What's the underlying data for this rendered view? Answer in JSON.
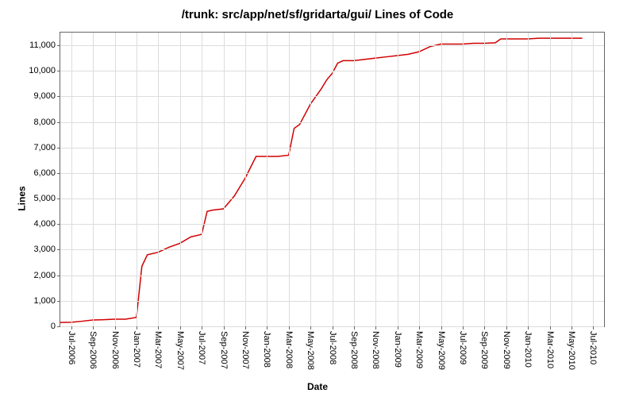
{
  "chart_data": {
    "type": "line",
    "title": "/trunk: src/app/net/sf/gridarta/gui/ Lines of Code",
    "xlabel": "Date",
    "ylabel": "Lines",
    "ylim": [
      0,
      11500
    ],
    "y_ticks": [
      0,
      1000,
      2000,
      3000,
      4000,
      5000,
      6000,
      7000,
      8000,
      9000,
      10000,
      11000
    ],
    "y_tick_labels": [
      "0",
      "1,000",
      "2,000",
      "3,000",
      "4,000",
      "5,000",
      "6,000",
      "7,000",
      "8,000",
      "9,000",
      "10,000",
      "11,000"
    ],
    "x_ticks": [
      "Jul-2006",
      "Sep-2006",
      "Nov-2006",
      "Jan-2007",
      "Mar-2007",
      "May-2007",
      "Jul-2007",
      "Sep-2007",
      "Nov-2007",
      "Jan-2008",
      "Mar-2008",
      "May-2008",
      "Jul-2008",
      "Sep-2008",
      "Nov-2008",
      "Jan-2009",
      "Mar-2009",
      "May-2009",
      "Jul-2009",
      "Sep-2009",
      "Nov-2009",
      "Jan-2010",
      "Mar-2010",
      "May-2010",
      "Jul-2010"
    ],
    "series": [
      {
        "name": "Lines of Code",
        "color": "#d00000",
        "points": [
          {
            "x": "Jun-2006",
            "y": 150
          },
          {
            "x": "Jul-2006",
            "y": 160
          },
          {
            "x": "Aug-2006",
            "y": 200
          },
          {
            "x": "Sep-2006",
            "y": 250
          },
          {
            "x": "Oct-2006",
            "y": 260
          },
          {
            "x": "Nov-2006",
            "y": 280
          },
          {
            "x": "Dec-2006",
            "y": 280
          },
          {
            "x": "Jan-2007",
            "y": 350
          },
          {
            "x": "Jan-2007b",
            "y": 2350
          },
          {
            "x": "Feb-2007",
            "y": 2800
          },
          {
            "x": "Mar-2007",
            "y": 2900
          },
          {
            "x": "Apr-2007",
            "y": 3100
          },
          {
            "x": "May-2007",
            "y": 3250
          },
          {
            "x": "Jun-2007",
            "y": 3500
          },
          {
            "x": "Jul-2007",
            "y": 3600
          },
          {
            "x": "Jul-2007b",
            "y": 4500
          },
          {
            "x": "Aug-2007",
            "y": 4550
          },
          {
            "x": "Sep-2007",
            "y": 4600
          },
          {
            "x": "Oct-2007",
            "y": 5100
          },
          {
            "x": "Oct-2007b",
            "y": 5450
          },
          {
            "x": "Nov-2007",
            "y": 5800
          },
          {
            "x": "Dec-2007",
            "y": 6650
          },
          {
            "x": "Jan-2008",
            "y": 6650
          },
          {
            "x": "Feb-2008",
            "y": 6650
          },
          {
            "x": "Mar-2008",
            "y": 6700
          },
          {
            "x": "Mar-2008b",
            "y": 7750
          },
          {
            "x": "Apr-2008",
            "y": 7900
          },
          {
            "x": "May-2008",
            "y": 8700
          },
          {
            "x": "Jun-2008",
            "y": 9300
          },
          {
            "x": "Jun-2008b",
            "y": 9650
          },
          {
            "x": "Jul-2008",
            "y": 9900
          },
          {
            "x": "Jul-2008b",
            "y": 10300
          },
          {
            "x": "Aug-2008",
            "y": 10400
          },
          {
            "x": "Sep-2008",
            "y": 10400
          },
          {
            "x": "Oct-2008",
            "y": 10450
          },
          {
            "x": "Nov-2008",
            "y": 10500
          },
          {
            "x": "Dec-2008",
            "y": 10550
          },
          {
            "x": "Jan-2009",
            "y": 10600
          },
          {
            "x": "Feb-2009",
            "y": 10650
          },
          {
            "x": "Mar-2009",
            "y": 10750
          },
          {
            "x": "Apr-2009",
            "y": 10950
          },
          {
            "x": "Apr-2009b",
            "y": 11000
          },
          {
            "x": "May-2009",
            "y": 11050
          },
          {
            "x": "Jun-2009",
            "y": 11050
          },
          {
            "x": "Jul-2009",
            "y": 11050
          },
          {
            "x": "Aug-2009",
            "y": 11080
          },
          {
            "x": "Sep-2009",
            "y": 11080
          },
          {
            "x": "Oct-2009",
            "y": 11100
          },
          {
            "x": "Oct-2009b",
            "y": 11250
          },
          {
            "x": "Nov-2009",
            "y": 11250
          },
          {
            "x": "Dec-2009",
            "y": 11250
          },
          {
            "x": "Jan-2010",
            "y": 11250
          },
          {
            "x": "Feb-2010",
            "y": 11280
          },
          {
            "x": "Mar-2010",
            "y": 11280
          },
          {
            "x": "Apr-2010",
            "y": 11280
          },
          {
            "x": "May-2010",
            "y": 11280
          },
          {
            "x": "Jun-2010",
            "y": 11280
          }
        ]
      }
    ],
    "x_index_range": [
      -1,
      49
    ]
  }
}
